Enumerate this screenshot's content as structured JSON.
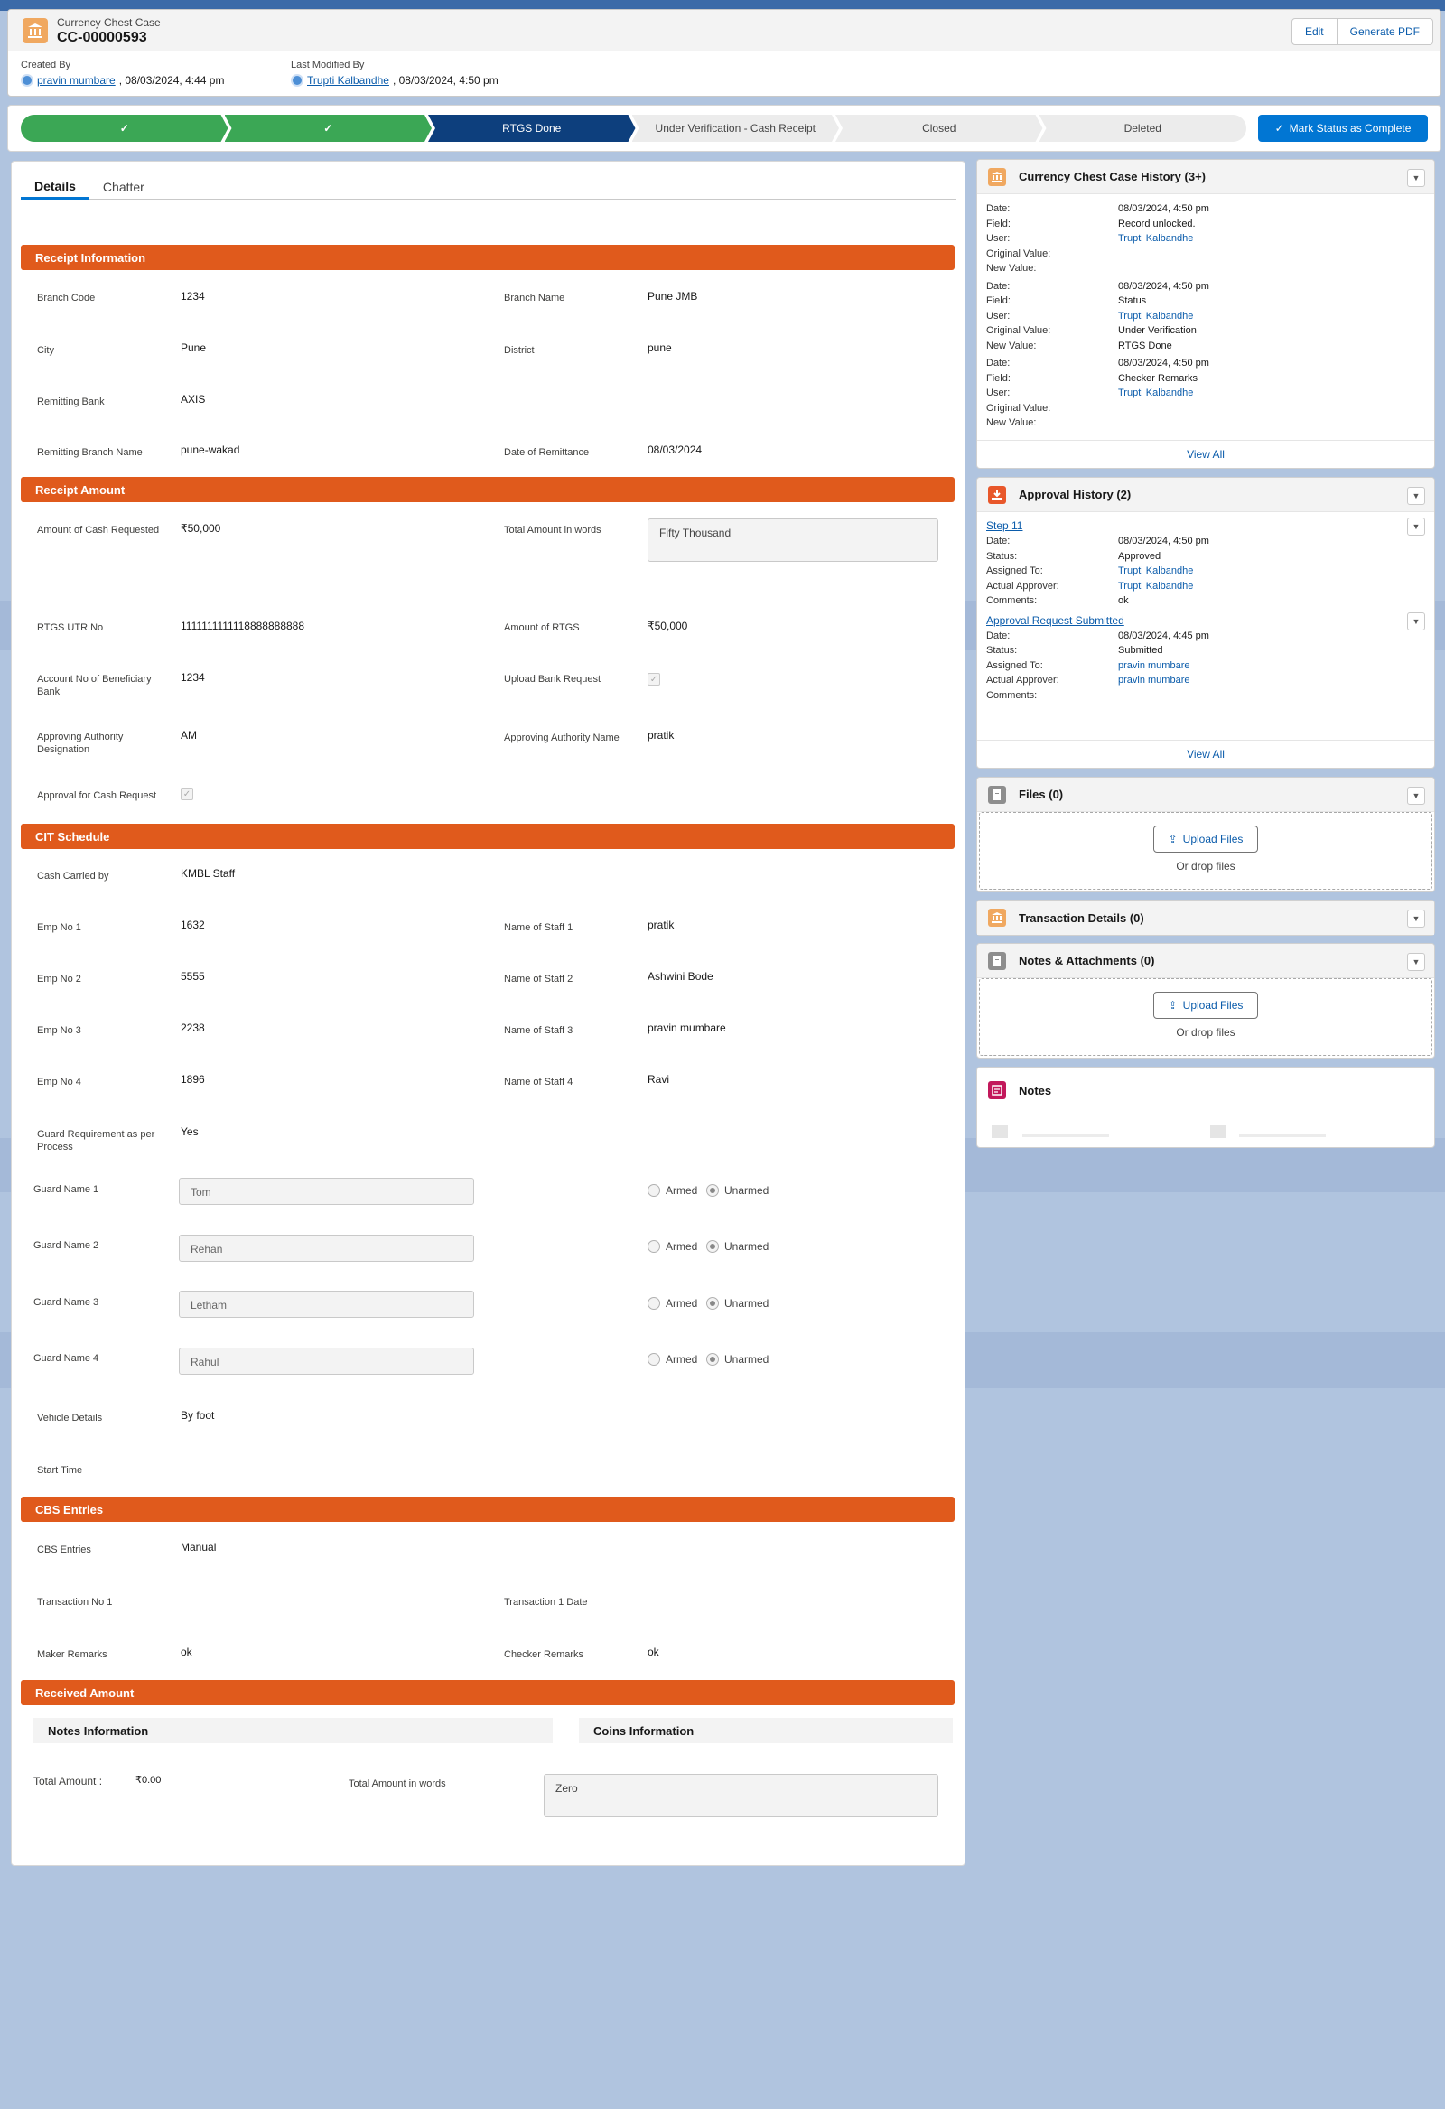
{
  "record": {
    "type": "Currency Chest Case",
    "name": "CC-00000593",
    "edit_label": "Edit",
    "pdf_label": "Generate PDF",
    "created_by_label": "Created By",
    "created_by_user": "pravin mumbare",
    "created_by_date": ", 08/03/2024, 4:44 pm",
    "modified_by_label": "Last Modified By",
    "modified_by_user": "Trupti Kalbandhe",
    "modified_by_date": ", 08/03/2024, 4:50 pm"
  },
  "path": {
    "steps": [
      {
        "label": "✓",
        "state": "done"
      },
      {
        "label": "✓",
        "state": "done"
      },
      {
        "label": "RTGS Done",
        "state": "current"
      },
      {
        "label": "Under Verification - Cash Receipt",
        "state": "todo"
      },
      {
        "label": "Closed",
        "state": "todo"
      },
      {
        "label": "Deleted",
        "state": "todo"
      }
    ],
    "mark_complete_label": "Mark Status as Complete"
  },
  "tabs": {
    "details": "Details",
    "chatter": "Chatter"
  },
  "receipt_info": {
    "title": "Receipt Information",
    "branch_code_label": "Branch Code",
    "branch_code": "1234",
    "branch_name_label": "Branch Name",
    "branch_name": "Pune JMB",
    "city_label": "City",
    "city": "Pune",
    "district_label": "District",
    "district": "pune",
    "remitting_bank_label": "Remitting Bank",
    "remitting_bank": "AXIS",
    "remitting_branch_label": "Remitting Branch Name",
    "remitting_branch": "pune-wakad",
    "date_of_remittance_label": "Date of Remittance",
    "date_of_remittance": "08/03/2024"
  },
  "receipt_amount": {
    "title": "Receipt Amount",
    "amount_requested_label": "Amount of Cash Requested",
    "amount_requested": "₹50,000",
    "total_words_label": "Total Amount in words",
    "total_words": "Fifty  Thousand",
    "utr_label": "RTGS UTR No",
    "utr": "1111111111118888888888",
    "amount_rtgs_label": "Amount of RTGS",
    "amount_rtgs": "₹50,000",
    "account_label_1": "Account No of Beneficiary",
    "account_label_2": "Bank",
    "account": "1234",
    "upload_bank_label": "Upload Bank Request",
    "auth_desig_label_1": "Approving Authority",
    "auth_desig_label_2": "Designation",
    "auth_desig": "AM",
    "auth_name_label": "Approving Authority Name",
    "auth_name": "pratik",
    "approval_cash_label": "Approval for Cash Request"
  },
  "cit": {
    "title": "CIT Schedule",
    "cash_carried_label": "Cash Carried by",
    "cash_carried": "KMBL Staff",
    "emps": [
      {
        "no_label": "Emp No 1",
        "no": "1632",
        "name_label": "Name of Staff 1",
        "name": "pratik"
      },
      {
        "no_label": "Emp No 2",
        "no": "5555",
        "name_label": "Name of Staff 2",
        "name": "Ashwini Bode"
      },
      {
        "no_label": "Emp No 3",
        "no": "2238",
        "name_label": "Name of Staff 3",
        "name": "pravin mumbare"
      },
      {
        "no_label": "Emp No 4",
        "no": "1896",
        "name_label": "Name of Staff 4",
        "name": "Ravi"
      }
    ],
    "guard_req_label_1": "Guard Requirement as per",
    "guard_req_label_2": "Process",
    "guard_req": "Yes",
    "guards": [
      {
        "label": "Guard Name 1",
        "value": "Tom"
      },
      {
        "label": "Guard Name 2",
        "value": "Rehan"
      },
      {
        "label": "Guard Name 3",
        "value": "Letham"
      },
      {
        "label": "Guard Name 4",
        "value": "Rahul"
      }
    ],
    "armed_label": "Armed",
    "unarmed_label": "Unarmed",
    "vehicle_label": "Vehicle Details",
    "vehicle": "By foot",
    "start_time_label": "Start Time"
  },
  "cbs": {
    "title": "CBS Entries",
    "entries_label": "CBS Entries",
    "entries": "Manual",
    "txn_no_label": "Transaction No 1",
    "txn_date_label": "Transaction 1 Date",
    "maker_label": "Maker Remarks",
    "maker": "ok",
    "checker_label": "Checker Remarks",
    "checker": "ok"
  },
  "received": {
    "title": "Received Amount",
    "notes_info": "Notes Information",
    "coins_info": "Coins Information",
    "total_label": "Total Amount :",
    "total": "₹0.00",
    "words_label": "Total Amount in words",
    "words": "Zero"
  },
  "history": {
    "title": "Currency Chest Case History (3+)",
    "labels": {
      "date": "Date:",
      "field": "Field:",
      "user": "User:",
      "orig": "Original Value:",
      "new": "New Value:"
    },
    "entries": [
      {
        "date": "08/03/2024, 4:50 pm",
        "field": "Record unlocked.",
        "user": "Trupti Kalbandhe",
        "orig": "",
        "new": ""
      },
      {
        "date": "08/03/2024, 4:50 pm",
        "field": "Status",
        "user": "Trupti Kalbandhe",
        "orig": "Under Verification",
        "new": "RTGS Done"
      },
      {
        "date": "08/03/2024, 4:50 pm",
        "field": "Checker Remarks",
        "user": "Trupti Kalbandhe",
        "orig": "",
        "new": ""
      }
    ],
    "view_all": "View All"
  },
  "approval": {
    "title": "Approval History (2)",
    "labels": {
      "date": "Date:",
      "status": "Status:",
      "assigned": "Assigned To:",
      "actual": "Actual Approver:",
      "comments": "Comments:"
    },
    "steps": [
      {
        "name": "Step 11",
        "date": "08/03/2024, 4:50 pm",
        "status": "Approved",
        "assigned": "Trupti Kalbandhe",
        "actual": "Trupti Kalbandhe",
        "comments": "ok"
      },
      {
        "name": "Approval Request Submitted",
        "date": "08/03/2024, 4:45 pm",
        "status": "Submitted",
        "assigned": "pravin mumbare",
        "actual": "pravin mumbare",
        "comments": ""
      }
    ],
    "view_all": "View All"
  },
  "files": {
    "title": "Files (0)",
    "upload": "Upload Files",
    "drop": "Or drop files"
  },
  "transactions": {
    "title": "Transaction Details (0)"
  },
  "notes_attach": {
    "title": "Notes & Attachments (0)",
    "upload": "Upload Files",
    "drop": "Or drop files"
  },
  "notes": {
    "title": "Notes"
  },
  "colors": {
    "accent": "#e05a1c",
    "brand": "#0176d3",
    "path_done": "#3ba755",
    "path_current": "#0d3f7d"
  }
}
